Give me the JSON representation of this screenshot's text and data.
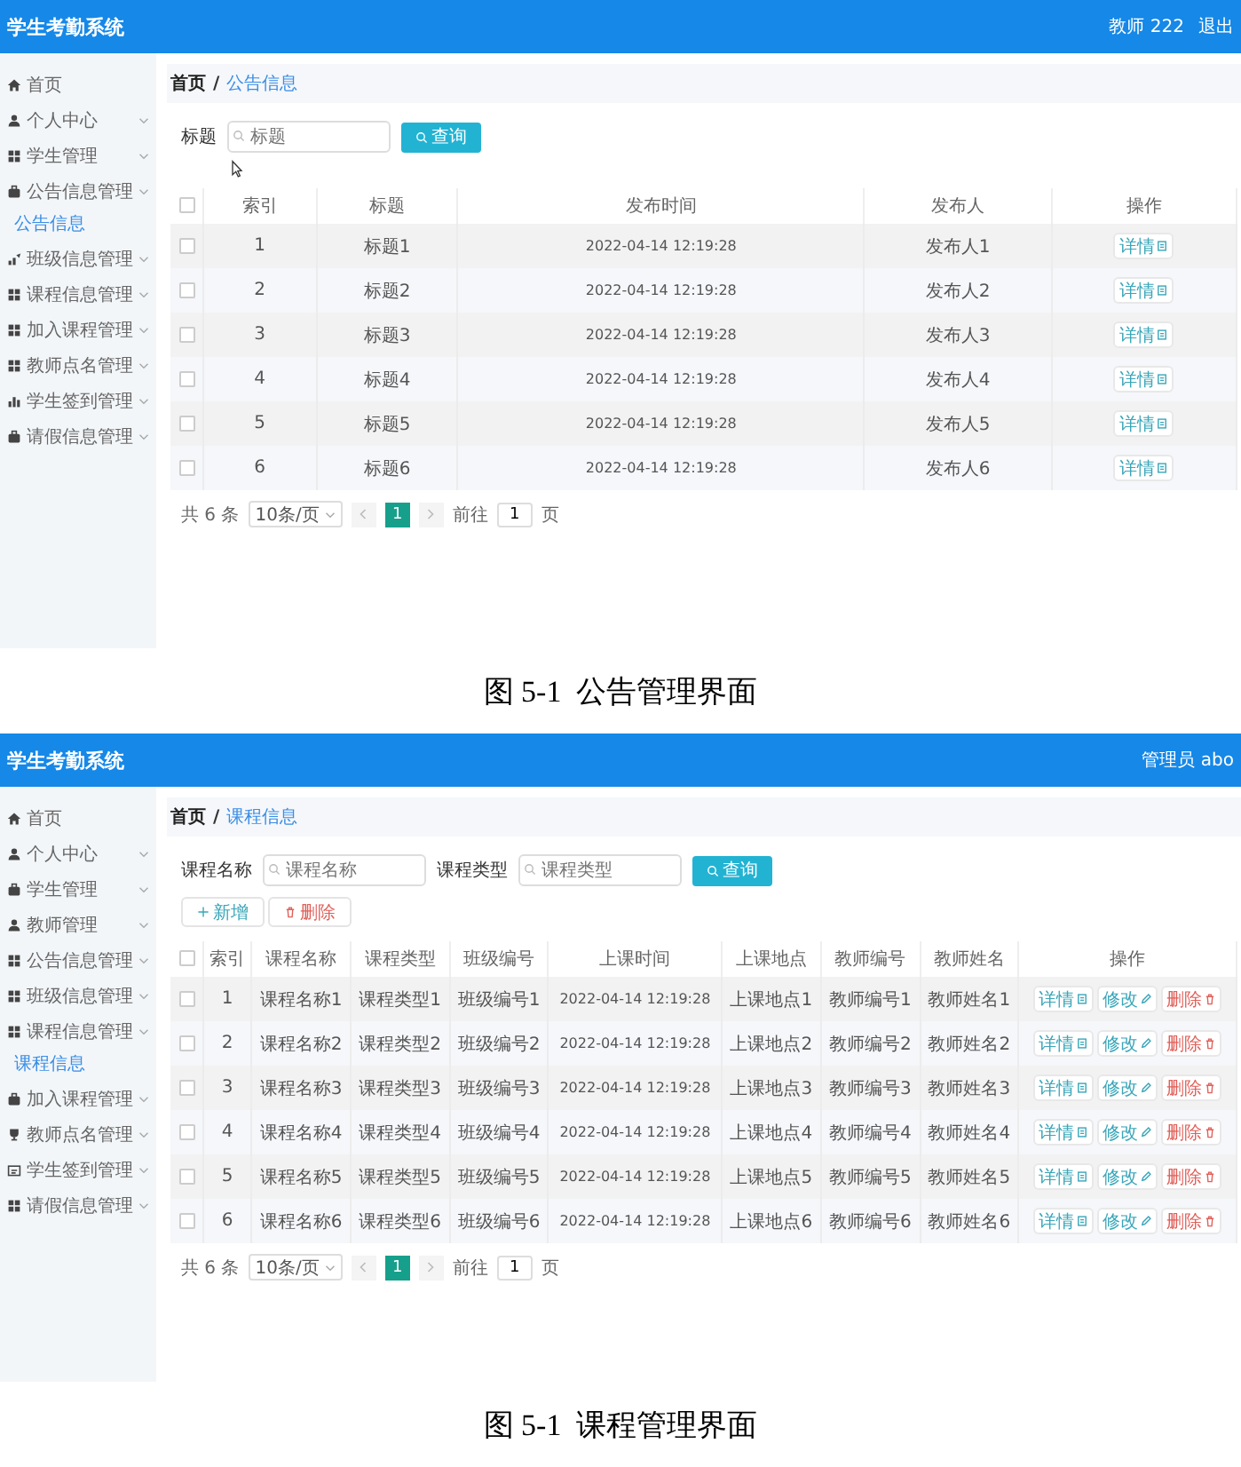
{
  "figures": [
    {
      "app": {
        "title": "学生考勤系统",
        "user": "教师 222",
        "logout": "退出"
      },
      "sidebar": [
        {
          "label": "首页",
          "kind": "home",
          "has_submenu": false
        },
        {
          "label": "个人中心",
          "kind": "person",
          "has_submenu": true
        },
        {
          "label": "学生管理",
          "kind": "grid",
          "has_submenu": true
        },
        {
          "label": "公告信息管理",
          "kind": "bag",
          "has_submenu": true,
          "children": [
            {
              "label": "公告信息",
              "selected": true
            }
          ]
        },
        {
          "label": "班级信息管理",
          "kind": "chart",
          "has_submenu": true
        },
        {
          "label": "课程信息管理",
          "kind": "grid",
          "has_submenu": true
        },
        {
          "label": "加入课程管理",
          "kind": "grid",
          "has_submenu": true
        },
        {
          "label": "教师点名管理",
          "kind": "grid",
          "has_submenu": true
        },
        {
          "label": "学生签到管理",
          "kind": "bars",
          "has_submenu": true
        },
        {
          "label": "请假信息管理",
          "kind": "bag",
          "has_submenu": true
        }
      ],
      "breadcrumb": [
        "首页",
        "公告信息"
      ],
      "breadcrumb_separator": "/",
      "search_fields": [
        {
          "label": "标题",
          "placeholder": "标题"
        }
      ],
      "search_button": "查询",
      "table": {
        "header_checked": false,
        "columns": [
          "索引",
          "标题",
          "发布时间",
          "发布人",
          "操作"
        ],
        "rows": [
          {
            "checked": false,
            "cells": [
              "1",
              "标题1",
              "2022-04-14 12:19:28",
              "发布人1"
            ],
            "actions": [
              {
                "label": "详情",
                "kind": "detail"
              }
            ]
          },
          {
            "checked": false,
            "cells": [
              "2",
              "标题2",
              "2022-04-14 12:19:28",
              "发布人2"
            ],
            "actions": [
              {
                "label": "详情",
                "kind": "detail"
              }
            ]
          },
          {
            "checked": false,
            "cells": [
              "3",
              "标题3",
              "2022-04-14 12:19:28",
              "发布人3"
            ],
            "actions": [
              {
                "label": "详情",
                "kind": "detail"
              }
            ]
          },
          {
            "checked": false,
            "cells": [
              "4",
              "标题4",
              "2022-04-14 12:19:28",
              "发布人4"
            ],
            "actions": [
              {
                "label": "详情",
                "kind": "detail"
              }
            ]
          },
          {
            "checked": false,
            "cells": [
              "5",
              "标题5",
              "2022-04-14 12:19:28",
              "发布人5"
            ],
            "actions": [
              {
                "label": "详情",
                "kind": "detail"
              }
            ]
          },
          {
            "checked": false,
            "cells": [
              "6",
              "标题6",
              "2022-04-14 12:19:28",
              "发布人6"
            ],
            "actions": [
              {
                "label": "详情",
                "kind": "detail"
              }
            ]
          }
        ]
      },
      "pagination": {
        "total": "共 6 条",
        "page_size": "10条/页",
        "pages": [
          {
            "label": "1",
            "selected": true
          }
        ],
        "goto_label": "前往",
        "goto_value": "1",
        "goto_suffix": "页"
      },
      "caption": "图 5-1  公告管理界面"
    },
    {
      "app": {
        "title": "学生考勤系统",
        "user": "管理员 abo"
      },
      "sidebar": [
        {
          "label": "首页",
          "kind": "home",
          "has_submenu": false
        },
        {
          "label": "个人中心",
          "kind": "person",
          "has_submenu": true
        },
        {
          "label": "学生管理",
          "kind": "bag",
          "has_submenu": true
        },
        {
          "label": "教师管理",
          "kind": "person",
          "has_submenu": true
        },
        {
          "label": "公告信息管理",
          "kind": "grid",
          "has_submenu": true
        },
        {
          "label": "班级信息管理",
          "kind": "grid",
          "has_submenu": true
        },
        {
          "label": "课程信息管理",
          "kind": "grid",
          "has_submenu": true,
          "children": [
            {
              "label": "课程信息",
              "selected": true
            }
          ]
        },
        {
          "label": "加入课程管理",
          "kind": "bag",
          "has_submenu": true
        },
        {
          "label": "教师点名管理",
          "kind": "cup",
          "has_submenu": true
        },
        {
          "label": "学生签到管理",
          "kind": "card",
          "has_submenu": true
        },
        {
          "label": "请假信息管理",
          "kind": "grid",
          "has_submenu": true
        }
      ],
      "breadcrumb": [
        "首页",
        "课程信息"
      ],
      "breadcrumb_separator": "/",
      "search_fields": [
        {
          "label": "课程名称",
          "placeholder": "课程名称"
        },
        {
          "label": "课程类型",
          "placeholder": "课程类型"
        }
      ],
      "search_button": "查询",
      "toolbar": [
        {
          "label": "新增",
          "kind": "add"
        },
        {
          "label": "删除",
          "kind": "delete"
        }
      ],
      "table": {
        "header_checked": false,
        "columns": [
          "索引",
          "课程名称",
          "课程类型",
          "班级编号",
          "上课时间",
          "上课地点",
          "教师编号",
          "教师姓名",
          "操作"
        ],
        "rows": [
          {
            "checked": false,
            "cells": [
              "1",
              "课程名称1",
              "课程类型1",
              "班级编号1",
              "2022-04-14 12:19:28",
              "上课地点1",
              "教师编号1",
              "教师姓名1"
            ],
            "actions": [
              {
                "label": "详情",
                "kind": "detail"
              },
              {
                "label": "修改",
                "kind": "edit"
              },
              {
                "label": "删除",
                "kind": "delete"
              }
            ]
          },
          {
            "checked": false,
            "cells": [
              "2",
              "课程名称2",
              "课程类型2",
              "班级编号2",
              "2022-04-14 12:19:28",
              "上课地点2",
              "教师编号2",
              "教师姓名2"
            ],
            "actions": [
              {
                "label": "详情",
                "kind": "detail"
              },
              {
                "label": "修改",
                "kind": "edit"
              },
              {
                "label": "删除",
                "kind": "delete"
              }
            ]
          },
          {
            "checked": false,
            "cells": [
              "3",
              "课程名称3",
              "课程类型3",
              "班级编号3",
              "2022-04-14 12:19:28",
              "上课地点3",
              "教师编号3",
              "教师姓名3"
            ],
            "actions": [
              {
                "label": "详情",
                "kind": "detail"
              },
              {
                "label": "修改",
                "kind": "edit"
              },
              {
                "label": "删除",
                "kind": "delete"
              }
            ]
          },
          {
            "checked": false,
            "cells": [
              "4",
              "课程名称4",
              "课程类型4",
              "班级编号4",
              "2022-04-14 12:19:28",
              "上课地点4",
              "教师编号4",
              "教师姓名4"
            ],
            "actions": [
              {
                "label": "详情",
                "kind": "detail"
              },
              {
                "label": "修改",
                "kind": "edit"
              },
              {
                "label": "删除",
                "kind": "delete"
              }
            ]
          },
          {
            "checked": false,
            "cells": [
              "5",
              "课程名称5",
              "课程类型5",
              "班级编号5",
              "2022-04-14 12:19:28",
              "上课地点5",
              "教师编号5",
              "教师姓名5"
            ],
            "actions": [
              {
                "label": "详情",
                "kind": "detail"
              },
              {
                "label": "修改",
                "kind": "edit"
              },
              {
                "label": "删除",
                "kind": "delete"
              }
            ]
          },
          {
            "checked": false,
            "cells": [
              "6",
              "课程名称6",
              "课程类型6",
              "班级编号6",
              "2022-04-14 12:19:28",
              "上课地点6",
              "教师编号6",
              "教师姓名6"
            ],
            "actions": [
              {
                "label": "详情",
                "kind": "detail"
              },
              {
                "label": "修改",
                "kind": "edit"
              },
              {
                "label": "删除",
                "kind": "delete"
              }
            ]
          }
        ]
      },
      "pagination": {
        "total": "共 6 条",
        "page_size": "10条/页",
        "pages": [
          {
            "label": "1",
            "selected": true
          }
        ],
        "goto_label": "前往",
        "goto_value": "1",
        "goto_suffix": "页"
      },
      "caption": "图 5-1  课程管理界面"
    }
  ]
}
